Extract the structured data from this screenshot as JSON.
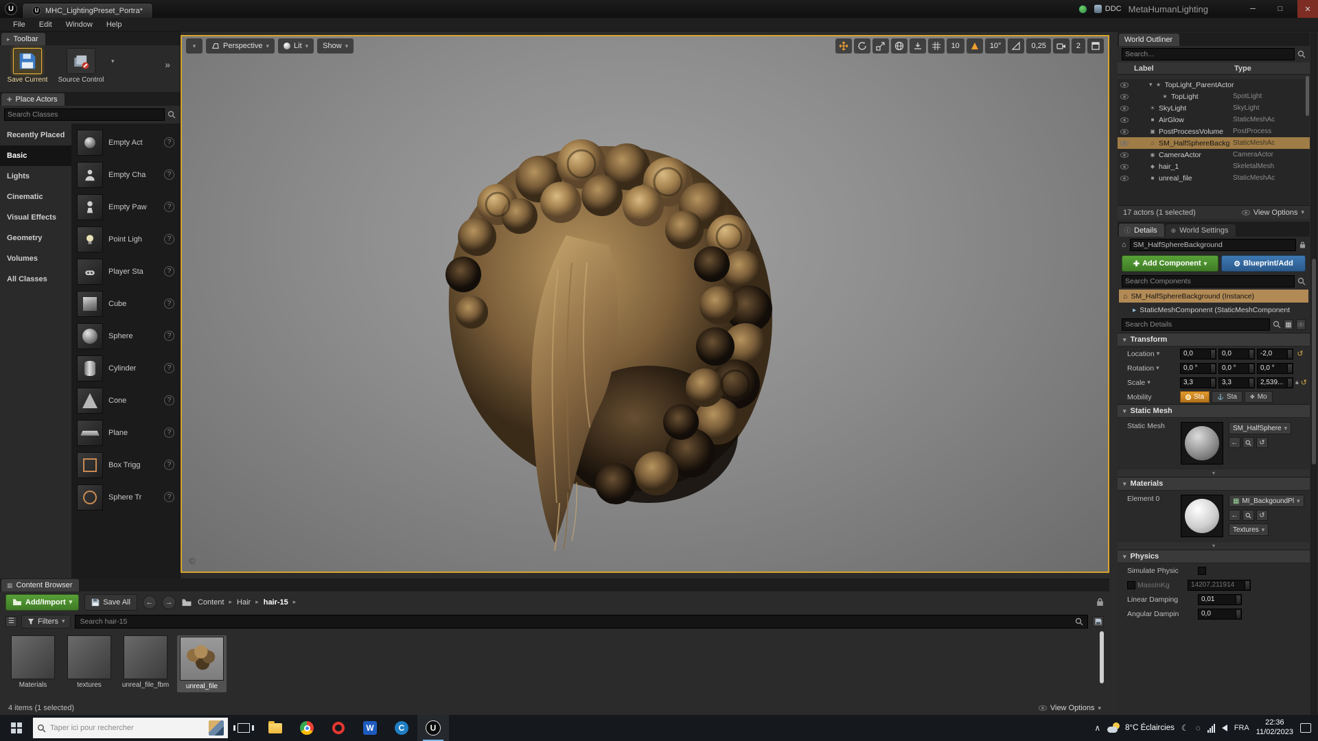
{
  "titlebar": {
    "tab": "MHC_LightingPreset_Portra*",
    "ddc_label": "DDC",
    "app_title": "MetaHumanLighting",
    "minimize": "─",
    "maximize": "□",
    "close": "✕"
  },
  "menubar": {
    "items": [
      "File",
      "Edit",
      "Window",
      "Help"
    ]
  },
  "toolbar": {
    "tab": "Toolbar",
    "save_current": "Save Current",
    "source_control": "Source Control"
  },
  "place_actors": {
    "tab": "Place Actors",
    "search_placeholder": "Search Classes",
    "categories": [
      "Recently Placed",
      "Basic",
      "Lights",
      "Cinematic",
      "Visual Effects",
      "Geometry",
      "Volumes",
      "All Classes"
    ],
    "items": [
      "Empty Act",
      "Empty Cha",
      "Empty Paw",
      "Point Ligh",
      "Player Sta",
      "Cube",
      "Sphere",
      "Cylinder",
      "Cone",
      "Plane",
      "Box Trigg",
      "Sphere Tr"
    ]
  },
  "viewport": {
    "perspective": "Perspective",
    "lit": "Lit",
    "show": "Show",
    "grid_snap": "10",
    "angle_snap": "10°",
    "scale_snap": "0,25",
    "camera_speed": "2"
  },
  "world_outliner": {
    "tab": "World Outliner",
    "search_placeholder": "Search...",
    "col_label": "Label",
    "col_type": "Type",
    "rows": [
      {
        "label": "TopLight_ParentActor",
        "type": ""
      },
      {
        "label": "TopLight",
        "type": "SpotLight"
      },
      {
        "label": "SkyLight",
        "type": "SkyLight"
      },
      {
        "label": "AirGlow",
        "type": "StaticMeshAc"
      },
      {
        "label": "PostProcessVolume",
        "type": "PostProcess"
      },
      {
        "label": "SM_HalfSphereBackg",
        "type": "StaticMeshAc"
      },
      {
        "label": "CameraActor",
        "type": "CameraActor"
      },
      {
        "label": "hair_1",
        "type": "SkeletalMesh"
      },
      {
        "label": "unreal_file",
        "type": "StaticMeshAc"
      }
    ],
    "status": "17 actors (1 selected)",
    "view_options": "View Options"
  },
  "details": {
    "tab_details": "Details",
    "tab_world_settings": "World Settings",
    "object_name": "SM_HalfSphereBackground",
    "add_component": "Add Component",
    "blueprint_button": "Blueprint/Add",
    "search_components_placeholder": "Search Components",
    "instance_row": "SM_HalfSphereBackground (Instance)",
    "component_row": "StaticMeshComponent (StaticMeshComponent",
    "search_details_placeholder": "Search Details",
    "transform_title": "Transform",
    "location_label": "Location",
    "location": [
      "0,0",
      "0,0",
      "-2,0"
    ],
    "rotation_label": "Rotation",
    "rotation": [
      "0,0 °",
      "0,0 °",
      "0,0 °"
    ],
    "scale_label": "Scale",
    "scale": [
      "3,3",
      "3,3",
      "2,539..."
    ],
    "mobility_label": "Mobility",
    "mobility": [
      "Sta",
      "Sta",
      "Mo"
    ],
    "static_mesh_title": "Static Mesh",
    "static_mesh_label": "Static Mesh",
    "static_mesh_value": "SM_HalfSphere",
    "materials_title": "Materials",
    "element_label": "Element 0",
    "material_value": "MI_BackgoundPl",
    "textures_button": "Textures",
    "physics_title": "Physics",
    "simulate_label": "Simulate Physic",
    "mass_label": "MassInKg",
    "mass_value": "14207,211914",
    "linear_label": "Linear Damping",
    "linear_value": "0,01",
    "angular_label": "Angular Dampin",
    "angular_value": "0,0"
  },
  "content_browser": {
    "tab": "Content Browser",
    "add_import": "Add/Import",
    "save_all": "Save All",
    "breadcrumbs": [
      "Content",
      "Hair",
      "hair-15"
    ],
    "filters": "Filters",
    "search_placeholder": "Search hair-15",
    "items": [
      "Materials",
      "textures",
      "unreal_file_fbm",
      "unreal_file"
    ],
    "status": "4 items (1 selected)",
    "view_options": "View Options"
  },
  "taskbar": {
    "search_placeholder": "Taper ici pour rechercher",
    "weather": "8°C Éclaircies",
    "language": "FRA",
    "time": "22:36",
    "date": "11/02/2023"
  }
}
